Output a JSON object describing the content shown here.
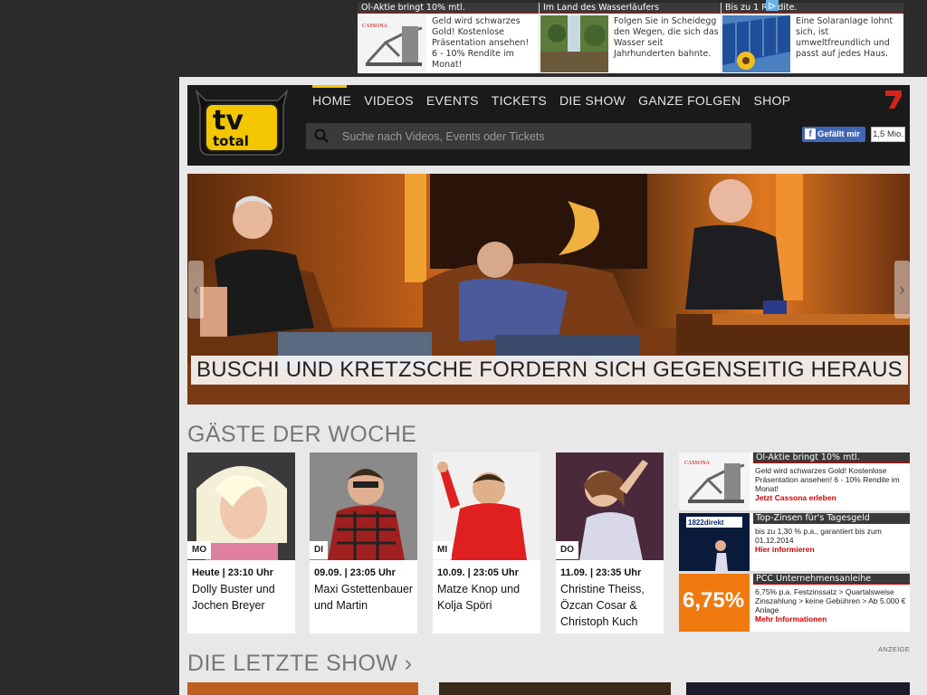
{
  "top_ads": [
    {
      "headline": "Öl-Aktie bringt 10% mtl.",
      "text": "Geld wird schwarzes Gold! Kostenlose Präsentation ansehen! 6 - 10% Rendite im Monat!",
      "brand": "CASSONA"
    },
    {
      "headline": "Im Land des Wasserläufers",
      "text": "Folgen Sie in Scheidegg den Wegen, die sich das Wasser seit Jahrhunderten bahnte."
    },
    {
      "headline": "Bis zu 1 Rendite.",
      "text": "Eine Solaranlage lohnt sich, ist umweltfreundlich und passt auf jedes Haus."
    }
  ],
  "header": {
    "logo_text_top": "tv",
    "logo_text_bottom": "total",
    "nav": [
      "HOME",
      "VIDEOS",
      "EVENTS",
      "TICKETS",
      "DIE SHOW",
      "GANZE FOLGEN",
      "SHOP"
    ],
    "search_placeholder": "Suche nach Videos, Events oder Tickets",
    "fb_like": "Gefällt mir",
    "fb_count": "1,5 Mio."
  },
  "hero": {
    "caption": "BUSCHI UND KRETZSCHE FORDERN SICH GEGENSEITIG HERAUS",
    "prev": "‹",
    "next": "›"
  },
  "guests_title": "GÄSTE DER WOCHE",
  "guests": [
    {
      "day": "MO",
      "time": "Heute | 23:10 Uhr",
      "name": "Dolly Buster und Jochen Breyer"
    },
    {
      "day": "DI",
      "time": "09.09. | 23:05 Uhr",
      "name": "Maxi Gstettenbauer und Martin"
    },
    {
      "day": "MI",
      "time": "10.09. | 23:05 Uhr",
      "name": "Matze Knop und Kolja Spöri"
    },
    {
      "day": "DO",
      "time": "11.09. | 23:35 Uhr",
      "name": "Christine Theiss, Özcan Cosar & Christoph Kuch"
    }
  ],
  "side_ads": [
    {
      "headline": "Öl-Aktie bringt 10% mtl.",
      "text": "Geld wird schwarzes Gold! Kostenlose Präsentation ansehen! 6 - 10% Rendite im Monat!",
      "link": "Jetzt Cassona erleben",
      "brand": "CASSONA"
    },
    {
      "headline": "Top-Zinsen für's Tagesgeld",
      "text": "bis zu 1,30 % p.a., garantiert bis zum 01.12.2014",
      "link": "Hier informieren",
      "brand": "1822direkt"
    },
    {
      "headline": "PCC Unternehmensanleihe",
      "text": "6,75% p.a. Festzinssatz > Quartalsweise Zinszahlung > keine Gebühren > Ab 5.000 € Anlage",
      "link": "Mehr Informationen",
      "badge": "6,75%"
    }
  ],
  "anzeige": "ANZEIGE",
  "last_show_title": "DIE LETZTE SHOW",
  "last_show_arrow": "›",
  "colors": {
    "accent": "#f2c600",
    "link_red": "#cc0000",
    "facebook": "#4267b2",
    "page_bg": "#e8e8e8",
    "outer_bg": "#2b2b2b"
  }
}
